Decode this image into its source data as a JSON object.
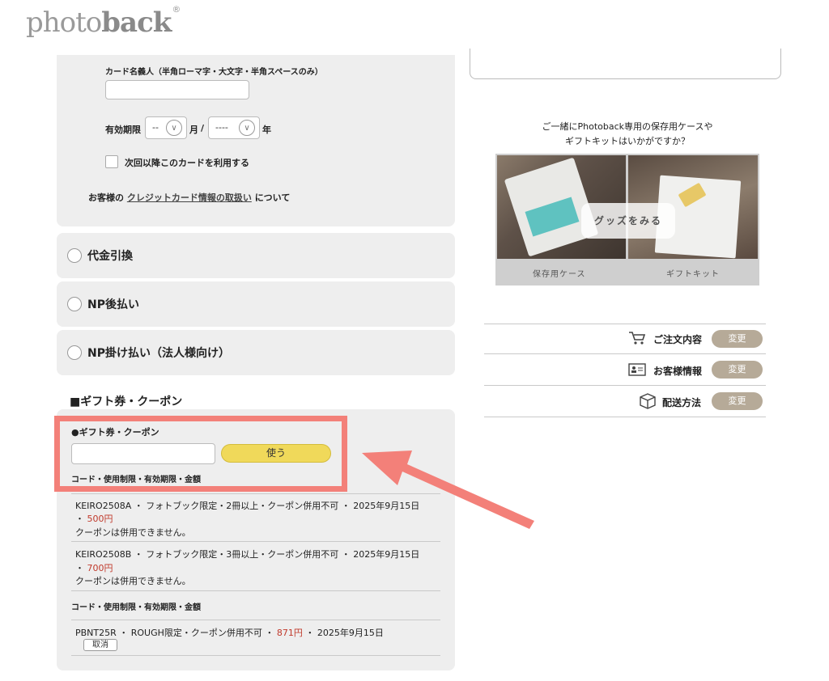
{
  "brand": {
    "logo_light": "photo",
    "logo_bold": "back",
    "logo_mark": "®"
  },
  "card_form": {
    "holder_label": "カード名義人（半角ローマ字・大文字・半角スペースのみ）",
    "holder_value": "",
    "expiry_label": "有効期限",
    "month_value": "--",
    "month_unit": "月",
    "separator": "/",
    "year_value": "----",
    "year_unit": "年",
    "save_card_label": "次回以降このカードを利用する",
    "info_prefix": "お客様の",
    "info_link": "クレジットカード情報の取扱い",
    "info_suffix": "について"
  },
  "payment_options": [
    {
      "label": "代金引換"
    },
    {
      "label": "NP後払い"
    },
    {
      "label": "NP掛け払い（法人様向け）"
    }
  ],
  "coupon_section": {
    "title": "■ギフト券・クーポン",
    "sub_title": "●ギフト券・クーポン",
    "input_value": "",
    "use_button": "使う",
    "columns_header": "コード・使用制限・有効期限・金額",
    "unusable_coupons": [
      {
        "text_a": "KEIRO2508A ・ フォトブック限定・2冊以上・クーポン併用不可 ・ 2025年9月15日",
        "text_b_prefix": "・ ",
        "price": "500円",
        "note": "クーポンは併用できません。"
      },
      {
        "text_a": "KEIRO2508B ・ フォトブック限定・3冊以上・クーポン併用不可 ・ 2025年9月15日",
        "text_b_prefix": "・ ",
        "price": "700円",
        "note": "クーポンは併用できません。"
      }
    ],
    "applied_header": "コード・使用制限・有効期限・金額",
    "applied": {
      "text_a": "PBNT25R ・ ROUGH限定・クーポン併用不可 ・ ",
      "price": "871円",
      "text_c": " ・ 2025年9月15日",
      "cancel_button": "取消"
    }
  },
  "promo": {
    "line1": "ご一緒にPhotoback専用の保存用ケースや",
    "line2": "ギフトキットはいかがですか？",
    "goods_button": "グッズをみる",
    "caption_left": "保存用ケース",
    "caption_right": "ギフトキット"
  },
  "order_summary": [
    {
      "icon": "cart-icon",
      "label": "ご注文内容",
      "button": "変更"
    },
    {
      "icon": "id-card-icon",
      "label": "お客様情報",
      "button": "変更"
    },
    {
      "icon": "box-icon",
      "label": "配送方法",
      "button": "変更"
    }
  ],
  "colors": {
    "highlight": "#f38079",
    "use_button": "#f0d95a",
    "change_button": "#b6aa98",
    "price": "#c0392b",
    "panel": "#eeeeee"
  }
}
